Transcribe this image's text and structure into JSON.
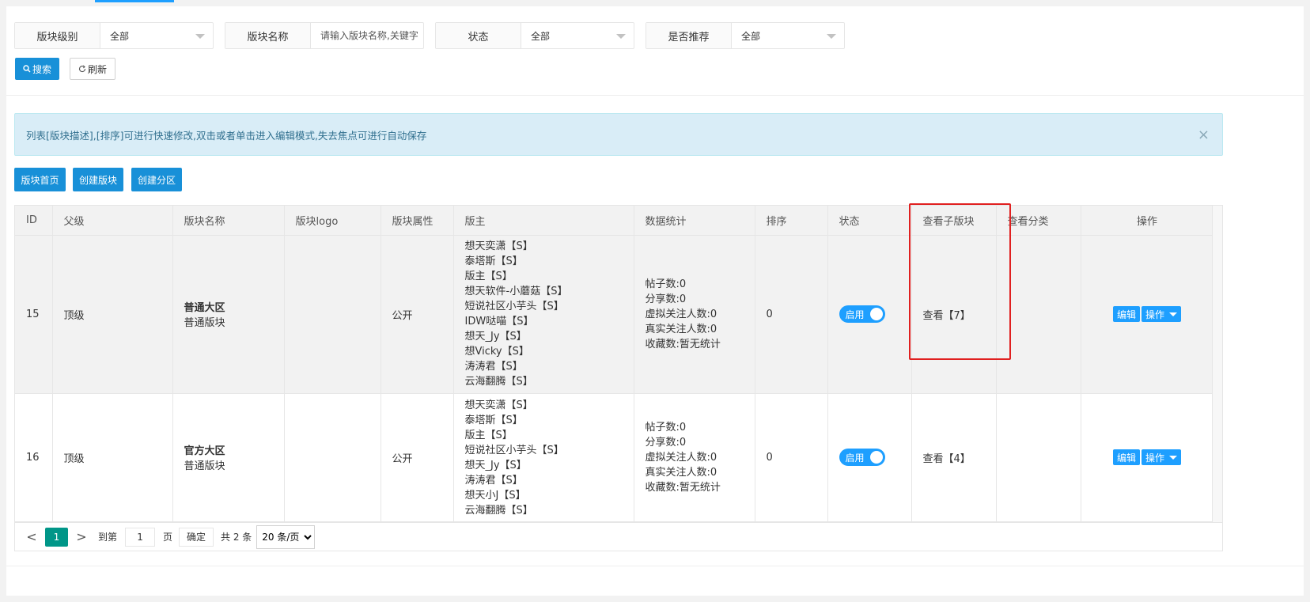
{
  "filters": [
    {
      "label": "版块级别",
      "value": "全部"
    },
    {
      "label": "版块名称",
      "placeholder": "请输入版块名称,关键字"
    },
    {
      "label": "状态",
      "value": "全部"
    },
    {
      "label": "是否推荐",
      "value": "全部"
    }
  ],
  "actions": {
    "search": "搜索",
    "refresh": "刷新"
  },
  "notice": "列表[版块描述],[排序]可进行快速修改,双击或者单击进入编辑模式,失去焦点可进行自动保存",
  "toolbar": {
    "home": "版块首页",
    "create_board": "创建版块",
    "create_zone": "创建分区"
  },
  "table": {
    "headers": [
      "ID",
      "父级",
      "版块名称",
      "版块logo",
      "版块属性",
      "版主",
      "数据统计",
      "排序",
      "状态",
      "查看子版块",
      "查看分类",
      "操作"
    ],
    "rows": [
      {
        "id": "15",
        "parent": "顶级",
        "name": "普通大区",
        "subtitle": "普通版块",
        "attr": "公开",
        "owners": [
          "想天奕潇【S】",
          "泰塔斯【S】",
          "版主【S】",
          "想天软件-小蘑菇【S】",
          "短说社区小芋头【S】",
          "IDW哒喵【S】",
          "想天_Jy【S】",
          "想Vicky【S】",
          "涛涛君【S】",
          "云海翻腾【S】"
        ],
        "stats": [
          "帖子数:0",
          "分享数:0",
          "虚拟关注人数:0",
          "真实关注人数:0",
          "收藏数:暂无统计"
        ],
        "sort": "0",
        "status": "启用",
        "children": "查看【7】",
        "edit": "编辑",
        "op": "操作"
      },
      {
        "id": "16",
        "parent": "顶级",
        "name": "官方大区",
        "subtitle": "普通版块",
        "attr": "公开",
        "owners": [
          "想天奕潇【S】",
          "泰塔斯【S】",
          "版主【S】",
          "短说社区小芋头【S】",
          "想天_Jy【S】",
          "涛涛君【S】",
          "想天小J【S】",
          "云海翻腾【S】"
        ],
        "stats": [
          "帖子数:0",
          "分享数:0",
          "虚拟关注人数:0",
          "真实关注人数:0",
          "收藏数:暂无统计"
        ],
        "sort": "0",
        "status": "启用",
        "children": "查看【4】",
        "edit": "编辑",
        "op": "操作"
      }
    ]
  },
  "pager": {
    "prev": "<",
    "current": "1",
    "next": ">",
    "goto": "到第",
    "page_input": "1",
    "page_unit": "页",
    "confirm": "确定",
    "total": "共 2 条",
    "page_size": "20 条/页"
  },
  "icons": {
    "search": "search-icon",
    "refresh": "refresh-icon",
    "close": "close-icon"
  },
  "colors": {
    "primary": "#1e9fff",
    "pager_active": "#009688",
    "highlight": "#e02020",
    "notice_bg": "#d9edf7"
  }
}
